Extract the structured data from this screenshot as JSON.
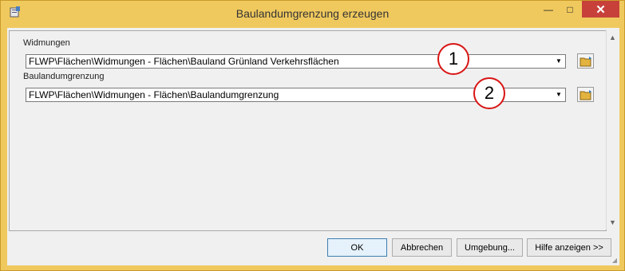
{
  "window": {
    "title": "Baulandumgrenzung erzeugen",
    "minimize_label": "—",
    "maximize_label": "□",
    "close_label": "✕"
  },
  "fields": [
    {
      "label": "Widmungen",
      "value": "FLWP\\Flächen\\Widmungen - Flächen\\Bauland Grünland Verkehrsflächen",
      "callout": "1"
    },
    {
      "label": "Baulandumgrenzung",
      "value": "FLWP\\Flächen\\Widmungen - Flächen\\Baulandumgrenzung",
      "callout": "2"
    }
  ],
  "buttons": {
    "ok": "OK",
    "cancel": "Abbrechen",
    "environment": "Umgebung...",
    "help": "Hilfe anzeigen >>"
  },
  "colors": {
    "frame": "#f0c95e",
    "close": "#c7413a",
    "callout_ring": "#d91414"
  },
  "icons": [
    "app-tool-icon",
    "dropdown-arrow-icon",
    "folder-browse-icon"
  ]
}
